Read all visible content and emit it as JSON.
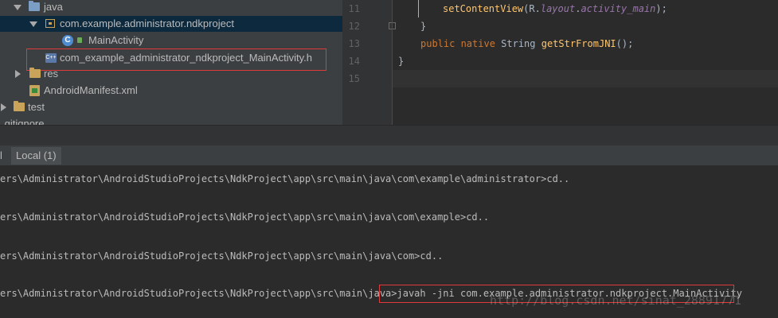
{
  "tree": {
    "java": "java",
    "package": "com.example.administrator.ndkproject",
    "main_activity": "MainActivity",
    "main_activity_icon": "C",
    "header_file": "com_example_administrator_ndkproject_MainActivity.h",
    "res": "res",
    "manifest": "AndroidManifest.xml",
    "test": "test",
    "gitignore": ".gitignore"
  },
  "editor": {
    "line_numbers": [
      "11",
      "12",
      "13",
      "14",
      "15"
    ],
    "line11": {
      "fn": "setContentView",
      "open": "(",
      "r": "R",
      "dot1": ".",
      "layout": "layout",
      "dot2": ".",
      "field": "activity_main",
      "close": ");"
    },
    "line12": "}",
    "line13": {
      "kw": "public native",
      "type": " String ",
      "fn": "getStrFromJNI",
      "rest": "();"
    },
    "line14": "}"
  },
  "terminal": {
    "tab_edge": "l",
    "tab_label": "Local (1)",
    "lines": [
      "ers\\Administrator\\AndroidStudioProjects\\NdkProject\\app\\src\\main\\java\\com\\example\\administrator>cd..",
      "ers\\Administrator\\AndroidStudioProjects\\NdkProject\\app\\src\\main\\java\\com\\example>cd..",
      "ers\\Administrator\\AndroidStudioProjects\\NdkProject\\app\\src\\main\\java\\com>cd..",
      "ers\\Administrator\\AndroidStudioProjects\\NdkProject\\app\\src\\main\\java>javah -jni com.example.administrator.ndkproject.MainActivity"
    ]
  },
  "watermark": "http://blog.csdn.net/sinat_28891771",
  "colors": {
    "highlight_border": "#e03a3a",
    "selection": "#0d293e",
    "keyword": "#cc7832",
    "function": "#ffc66d",
    "field": "#9876aa"
  }
}
